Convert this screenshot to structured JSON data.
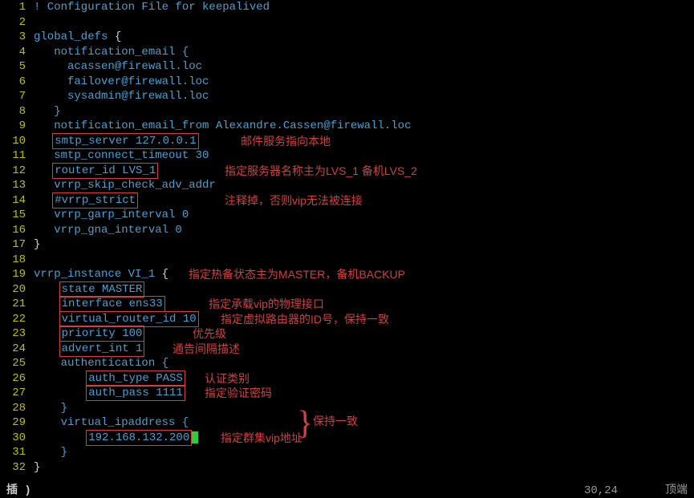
{
  "gutter": [
    "1",
    "2",
    "3",
    "4",
    "5",
    "6",
    "7",
    "8",
    "9",
    "10",
    "11",
    "12",
    "13",
    "14",
    "15",
    "16",
    "17",
    "18",
    "19",
    "20",
    "21",
    "22",
    "23",
    "24",
    "25",
    "26",
    "27",
    "28",
    "29",
    "30",
    "31",
    "32"
  ],
  "code": {
    "l1": "! Configuration File for keepalived",
    "l3a": "global_defs ",
    "l3b": "{",
    "l4": "   notification_email {",
    "l5": "     acassen@firewall.loc",
    "l6": "     failover@firewall.loc",
    "l7": "     sysadmin@firewall.loc",
    "l8": "   }",
    "l9": "   notification_email_from Alexandre.Cassen@firewall.loc",
    "l10pre": "   ",
    "l10box": "smtp_server 127.0.0.1",
    "l11": "   smtp_connect_timeout 30",
    "l12pre": "   ",
    "l12box": "router_id LVS_1",
    "l13": "   vrrp_skip_check_adv_addr",
    "l14pre": "   ",
    "l14box": "#vrrp_strict",
    "l15": "   vrrp_garp_interval 0",
    "l16": "   vrrp_gna_interval 0",
    "l17": "}",
    "l19a": "vrrp_instance VI_1 ",
    "l19b": "{",
    "l20pre": "    ",
    "l20box": "state MASTER",
    "l21pre": "    ",
    "l21box": "interface ens33",
    "l22pre": "    ",
    "l22box": "virtual_router_id 10",
    "l23pre": "    ",
    "l23box": "priority 100",
    "l24pre": "    ",
    "l24box": "advert_int 1",
    "l25": "    authentication {",
    "l26pre": "        ",
    "l26box": "auth_type PASS",
    "l27pre": "        ",
    "l27box": "auth_pass 1111",
    "l28": "    }",
    "l29": "    virtual_ipaddress {",
    "l30pre": "        ",
    "l30box": "192.168.132.200",
    "l31": "    }",
    "l32": "}"
  },
  "annot": {
    "a10": "邮件服务指向本地",
    "a12": "指定服务器名称主为LVS_1  备机LVS_2",
    "a14": "注释掉，否则vip无法被连接",
    "a19": "指定热备状态主为MASTER，备机BACKUP",
    "a21": "指定承载vip的物理接口",
    "a22": "指定虚拟路由器的ID号，保持一致",
    "a23": "优先级",
    "a24": "通告间隔描述",
    "a26": "认证类别",
    "a27": "指定验证密码",
    "a2627": "保持一致",
    "a30": "指定群集vip地址"
  },
  "status": {
    "left": "插 )",
    "mid": "30,24",
    "right": "顶端"
  }
}
